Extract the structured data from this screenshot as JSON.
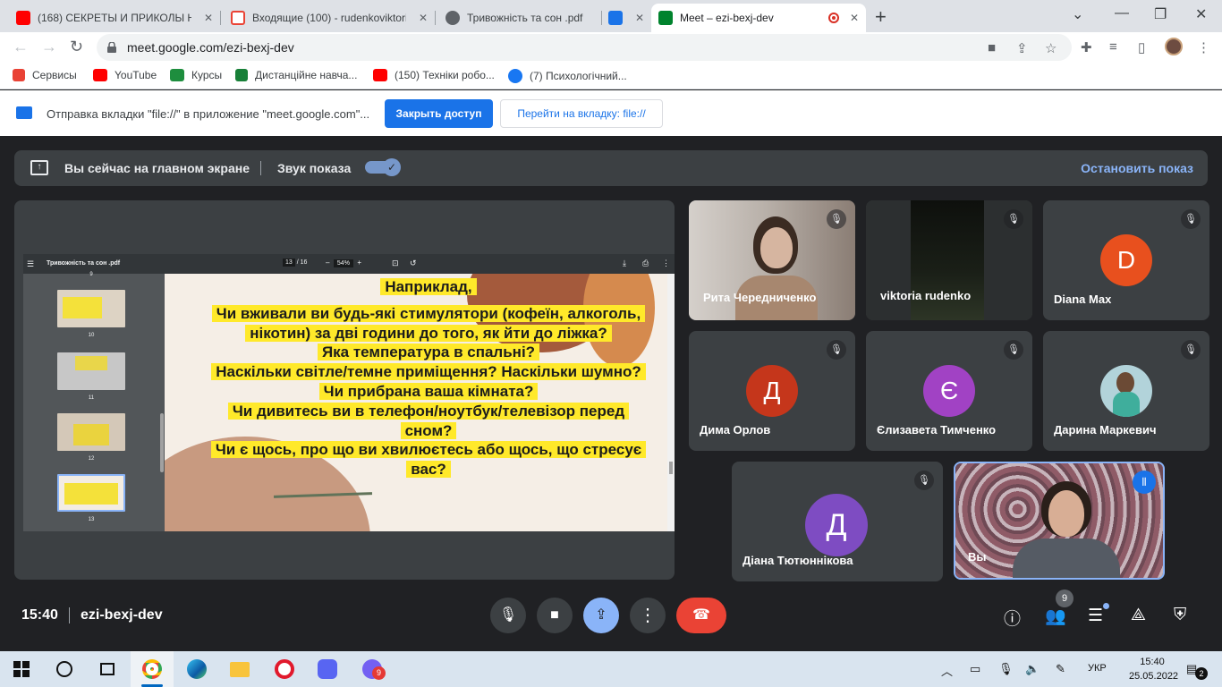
{
  "browser": {
    "tabs": [
      {
        "title": "(168) СЕКРЕТЫ И ПРИКОЛЫ НОВ",
        "favicon": "youtube-icon",
        "color": "#ff0000"
      },
      {
        "title": "Входящие (100) - rudenkoviktoria",
        "favicon": "gmail-icon",
        "color": "#ea4335"
      },
      {
        "title": "Тривожність та сон .pdf",
        "favicon": "globe-icon",
        "color": "#5f6368"
      },
      {
        "title": "",
        "favicon": "screen-icon",
        "color": "#1a73e8"
      },
      {
        "title": "Meet – ezi-bexj-dev",
        "favicon": "meet-icon",
        "color": "#00832d"
      }
    ],
    "url": "meet.google.com/ezi-bexj-dev",
    "bookmarks": [
      {
        "label": "Сервисы",
        "icon": "apps-grid-icon",
        "color": "#e94235"
      },
      {
        "label": "YouTube",
        "icon": "youtube-icon",
        "color": "#ff0000"
      },
      {
        "label": "Курсы",
        "icon": "classroom-icon",
        "color": "#1e8e3e"
      },
      {
        "label": "Дистанційне навча...",
        "icon": "sheets-icon",
        "color": "#188038"
      },
      {
        "label": "(150) Техніки робо...",
        "icon": "youtube-icon",
        "color": "#ff0000"
      },
      {
        "label": "(7) Психологічний...",
        "icon": "facebook-icon",
        "color": "#1877f2"
      }
    ],
    "infobar": {
      "message": "Отправка вкладки \"file://\" в приложение \"meet.google.com\"...",
      "primary_button": "Закрыть доступ",
      "secondary_button": "Перейти на вкладку: file://"
    }
  },
  "meet": {
    "banner": {
      "presenting_text": "Вы сейчас на главном экране",
      "audio_label": "Звук показа",
      "audio_on": true,
      "stop_label": "Остановить показ"
    },
    "pdf": {
      "filename": "Тривожність та сон .pdf",
      "page_current": "13",
      "page_total": "/ 16",
      "zoom": "54%",
      "thumb_labels": [
        "9",
        "10",
        "11",
        "12",
        "13"
      ],
      "slide_lines": [
        "Наприклад,",
        "Чи вживали ви будь-які стимулятори (кофеїн, алкоголь,",
        "нікотин) за дві години до того, як йти до ліжка?",
        "Яка температура в спальні?",
        "Наскільки світле/темне приміщення? Наскільки шумно?",
        "Чи прибрана ваша кімната?",
        "Чи дивитесь ви в телефон/ноутбук/телевізор перед",
        "сном?",
        "Чи є щось, про що ви хвилюєтесь або щось, що стресує",
        "вас?"
      ]
    },
    "participants": [
      {
        "name": "Рита Чередниченко",
        "type": "video",
        "muted": true
      },
      {
        "name": "viktoria rudenko",
        "type": "video",
        "muted": true
      },
      {
        "name": "Diana Max",
        "type": "avatar",
        "initial": "D",
        "color": "#e8501e",
        "muted": true
      },
      {
        "name": "Дима Орлов",
        "type": "avatar",
        "initial": "Д",
        "color": "#c5361b",
        "muted": true
      },
      {
        "name": "Єлизавета Тимченко",
        "type": "avatar",
        "initial": "Є",
        "color": "#a142c4",
        "muted": true
      },
      {
        "name": "Дарина Маркевич",
        "type": "photo",
        "muted": true
      },
      {
        "name": "Діана Тютюннікова",
        "type": "avatar",
        "initial": "Д",
        "color": "#7e4cc2",
        "muted": true
      },
      {
        "name": "Вы",
        "type": "video",
        "muted": false,
        "speaking": true
      }
    ],
    "footer": {
      "time": "15:40",
      "meeting_code": "ezi-bexj-dev",
      "participant_count": "9"
    }
  },
  "taskbar": {
    "apps": [
      "windows-start-icon",
      "search-icon",
      "task-view-icon",
      "chrome-icon",
      "edge-icon",
      "file-explorer-icon",
      "opera-icon",
      "discord-icon",
      "viber-icon"
    ],
    "viber_badge": "9",
    "language": "УКР",
    "time": "15:40",
    "date": "25.05.2022",
    "notifications": "2"
  }
}
